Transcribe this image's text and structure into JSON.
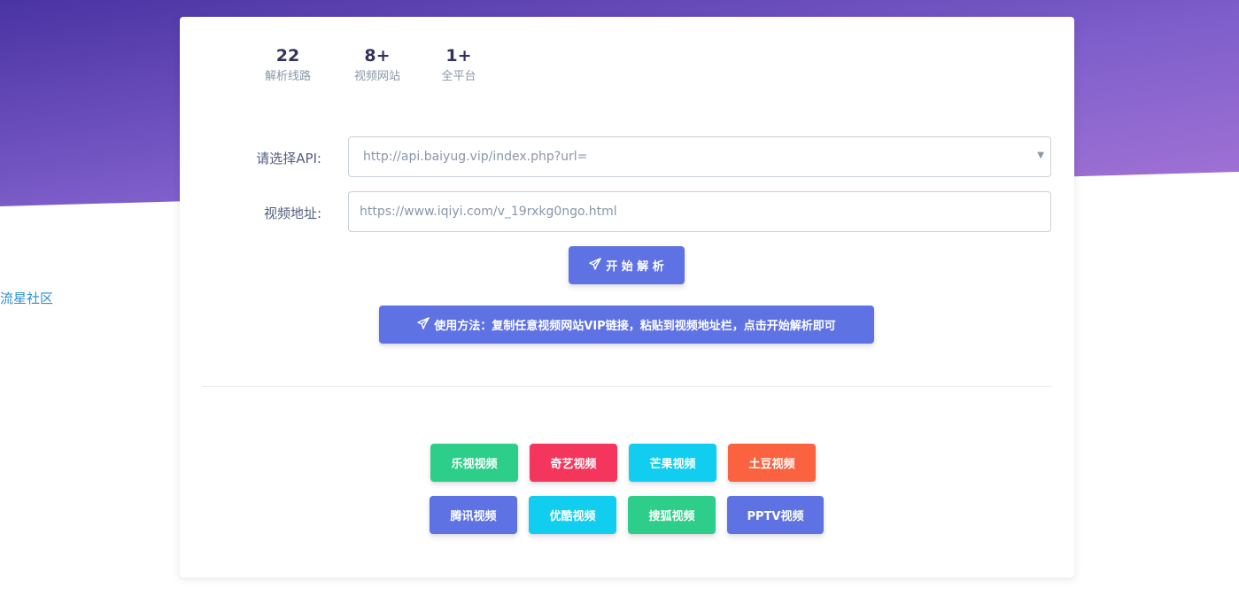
{
  "side_link": "流星社区",
  "stats": [
    {
      "value": "22",
      "label": "解析线路"
    },
    {
      "value": "8+",
      "label": "视频网站"
    },
    {
      "value": "1+",
      "label": "全平台"
    }
  ],
  "form": {
    "api_label": "请选择API:",
    "api_selected": "http://api.baiyug.vip/index.php?url=",
    "url_label": "视频地址:",
    "url_placeholder": "https://www.iqiyi.com/v_19rxkg0ngo.html",
    "start_button": "开 始 解 析",
    "usage_button": "使用方法：复制任意视频网站VIP链接，粘贴到视频地址栏，点击开始解析即可"
  },
  "sites": [
    {
      "label": "乐视视频",
      "color": "#2dce89"
    },
    {
      "label": "奇艺视频",
      "color": "#f5365c"
    },
    {
      "label": "芒果视频",
      "color": "#11cdef"
    },
    {
      "label": "土豆视频",
      "color": "#fb6340"
    },
    {
      "label": "腾讯视频",
      "color": "#5e72e4"
    },
    {
      "label": "优酷视频",
      "color": "#11cdef"
    },
    {
      "label": "搜狐视频",
      "color": "#2dce89"
    },
    {
      "label": "PPTV视频",
      "color": "#5e72e4"
    }
  ],
  "colors": {
    "hero_gradient_start": "#4a33a3",
    "hero_gradient_end": "#a574d6",
    "primary": "#5e72e4"
  },
  "icons": {
    "send": "paper-plane-icon"
  }
}
